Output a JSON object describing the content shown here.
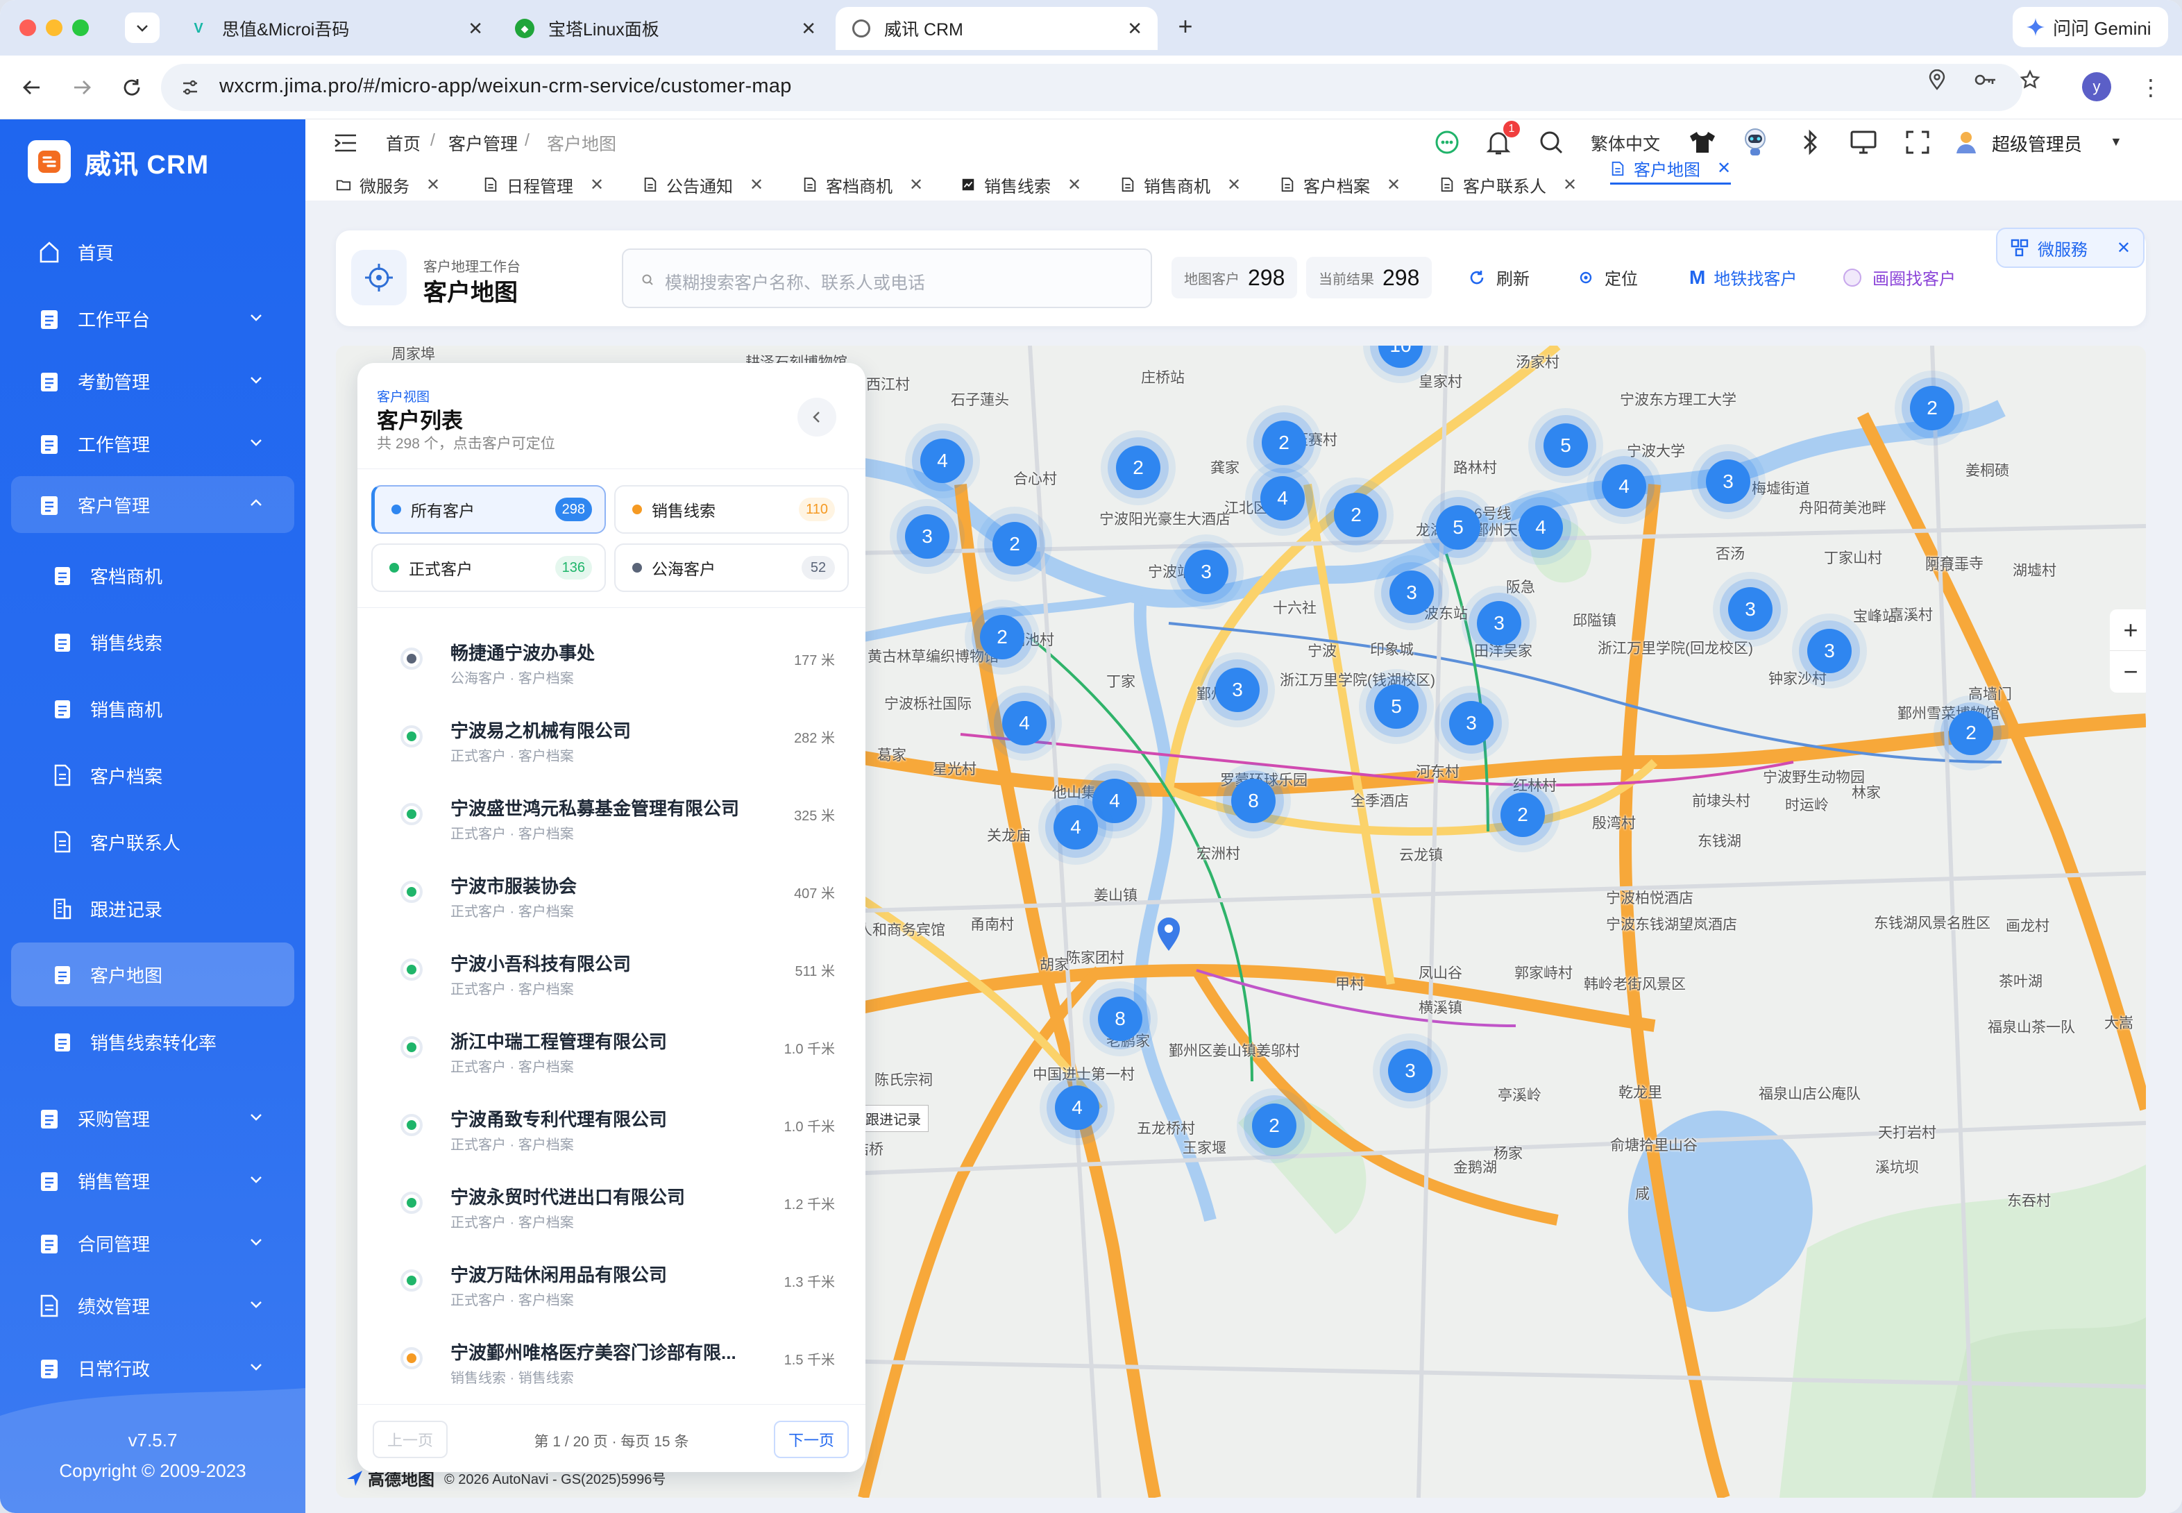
{
  "browser": {
    "tabs": [
      {
        "title": "思值&Microi吾码"
      },
      {
        "title": "宝塔Linux面板"
      },
      {
        "title": "威讯 CRM"
      }
    ],
    "gemini_label": "问问 Gemini",
    "url": "wxcrm.jima.pro/#/micro-app/weixun-crm-service/customer-map",
    "profile_initial": "y"
  },
  "sidebar": {
    "brand": "威讯 CRM",
    "items": [
      {
        "label": "首頁"
      },
      {
        "label": "工作平台"
      },
      {
        "label": "考勤管理"
      },
      {
        "label": "工作管理"
      },
      {
        "label": "客户管理"
      },
      {
        "label": "客档商机"
      },
      {
        "label": "销售线索"
      },
      {
        "label": "销售商机"
      },
      {
        "label": "客户档案"
      },
      {
        "label": "客户联系人"
      },
      {
        "label": "跟进记录"
      },
      {
        "label": "客户地图"
      },
      {
        "label": "销售线索转化率"
      },
      {
        "label": "采购管理"
      },
      {
        "label": "销售管理"
      },
      {
        "label": "合同管理"
      },
      {
        "label": "绩效管理"
      },
      {
        "label": "日常行政"
      }
    ],
    "version": "v7.5.7",
    "copyright": "Copyright © 2009-2023"
  },
  "header": {
    "breadcrumb": [
      "首页",
      "客户管理",
      "客户地图"
    ],
    "notification_count": "1",
    "language": "繁体中文",
    "user": "超级管理员"
  },
  "page_tabs": [
    {
      "label": "微服务"
    },
    {
      "label": "日程管理"
    },
    {
      "label": "公告通知"
    },
    {
      "label": "客档商机"
    },
    {
      "label": "销售线索"
    },
    {
      "label": "销售商机"
    },
    {
      "label": "客户档案"
    },
    {
      "label": "客户联系人"
    },
    {
      "label": "客户地图"
    }
  ],
  "toolbar": {
    "subtitle": "客户地理工作台",
    "title": "客户地图",
    "search_placeholder": "模糊搜索客户名称、联系人或电话",
    "map_customers_label": "地图客户",
    "map_customers_value": "298",
    "current_results_label": "当前结果",
    "current_results_value": "298",
    "refresh": "刷新",
    "locate": "定位",
    "metro": "地铁找客户",
    "draw": "画圈找客户",
    "microservice": "微服務"
  },
  "panel": {
    "eyebrow": "客户视图",
    "title": "客户列表",
    "subtitle": "共 298 个，点击客户可定位",
    "filters": [
      {
        "label": "所有客户",
        "count": "298",
        "color": "#2f86f0"
      },
      {
        "label": "销售线索",
        "count": "110",
        "color": "#f59a23"
      },
      {
        "label": "正式客户",
        "count": "136",
        "color": "#1fb56a"
      },
      {
        "label": "公海客户",
        "count": "52",
        "color": "#5a6478"
      }
    ],
    "customers": [
      {
        "name": "畅捷通宁波办事处",
        "meta": "公海客户 · 客户档案",
        "dist": "177 米",
        "color": "#5a6478"
      },
      {
        "name": "宁波易之机械有限公司",
        "meta": "正式客户 · 客户档案",
        "dist": "282 米",
        "color": "#1fb56a"
      },
      {
        "name": "宁波盛世鸿元私募基金管理有限公司",
        "meta": "正式客户 · 客户档案",
        "dist": "325 米",
        "color": "#1fb56a"
      },
      {
        "name": "宁波市服装协会",
        "meta": "正式客户 · 客户档案",
        "dist": "407 米",
        "color": "#1fb56a"
      },
      {
        "name": "宁波小吾科技有限公司",
        "meta": "正式客户 · 客户档案",
        "dist": "511 米",
        "color": "#1fb56a"
      },
      {
        "name": "浙江中瑞工程管理有限公司",
        "meta": "正式客户 · 客户档案",
        "dist": "1.0 千米",
        "color": "#1fb56a"
      },
      {
        "name": "宁波甬致专利代理有限公司",
        "meta": "正式客户 · 客户档案",
        "dist": "1.0 千米",
        "color": "#1fb56a"
      },
      {
        "name": "宁波永贸时代进出口有限公司",
        "meta": "正式客户 · 客户档案",
        "dist": "1.2 千米",
        "color": "#1fb56a"
      },
      {
        "name": "宁波万陆休闲用品有限公司",
        "meta": "正式客户 · 客户档案",
        "dist": "1.3 千米",
        "color": "#1fb56a"
      },
      {
        "name": "宁波鄞州唯格医疗美容门诊部有限...",
        "meta": "销售线索 · 销售线索",
        "dist": "1.5 千米",
        "color": "#f59a23"
      }
    ],
    "prev": "上一页",
    "page_info": "第 1 / 20 页 · 每页 15 条",
    "next": "下一页"
  },
  "map": {
    "clusters": [
      "10",
      "2",
      "2",
      "5",
      "4",
      "2",
      "4",
      "3",
      "4",
      "2",
      "3",
      "5",
      "4",
      "3",
      "2",
      "3",
      "3",
      "3",
      "2",
      "3",
      "3",
      "5",
      "3",
      "4",
      "2",
      "8",
      "4",
      "2",
      "4",
      "8",
      "3",
      "4",
      "2"
    ],
    "labels": [
      "周家埠",
      "耕泽石刻博物馆",
      "庄桥站",
      "西江村",
      "石子蓮头",
      "皇家村",
      "汤家村",
      "宁波东方理工大学",
      "宁波大学",
      "姜桐碛",
      "压赛村",
      "龚家",
      "高桥镇",
      "合心村",
      "路林村",
      "梅墟街道",
      "舟阳荷美池畔",
      "宁波阳光豪生大酒店",
      "江北区",
      "6号线",
      "龙湖宁波鄞州天街",
      "实皇岗桥村",
      "宁波站",
      "否汤",
      "丁家山村",
      "崇报寺",
      "湖墟村",
      "十六社",
      "波东站",
      "邱隘镇",
      "阪急",
      "嘉溪村",
      "阿育王寺",
      "宝峰站",
      "藕池村",
      "黄古林草编织博物馆",
      "田洋吴家",
      "宁波",
      "印象城",
      "浙江万里学院(回龙校区)",
      "钟家沙村",
      "高墙门",
      "宁波栎社国际",
      "丁家",
      "鄞州区",
      "浙江万里学院(钱湖校区)",
      "鄞州雪菜博物馆",
      "葛家",
      "星光村",
      "罗蒙环球乐园",
      "河东村",
      "红林村",
      "宁波野生动物园",
      "他山集",
      "全季酒店",
      "前埭头村",
      "时运岭",
      "林家",
      "关龙庙",
      "殷湾村",
      "东钱湖",
      "宏洲村",
      "云龙镇",
      "跟进记录",
      "姜山镇",
      "宁波柏悦酒店",
      "甬南村",
      "宁波人和商务宾馆",
      "宁波东钱湖望岚酒店",
      "东钱湖风景名胜区",
      "画龙村",
      "陈家团村",
      "凤山谷",
      "郭家峙村",
      "茶叶湖",
      "宁波",
      "杨家",
      "胡家",
      "甲村",
      "横溪镇",
      "韩岭老街风景区",
      "福泉山茶一队",
      "大嵩",
      "老鹏家",
      "鄞州区姜山镇姜邬村",
      "中国进士第一村",
      "陈氏宗祠",
      "亭溪岭",
      "乾龙里",
      "福泉山店公庵队",
      "五龙桥村",
      "天打岩村",
      "网桔桥",
      "俞塘拾里山谷",
      "王家堰",
      "杨家",
      "溪坑坝",
      "金鹅湖",
      "东吞村",
      "咸"
    ],
    "attribution": "© 2026 AutoNavi - GS(2025)5996号",
    "brand": "高德地图"
  }
}
